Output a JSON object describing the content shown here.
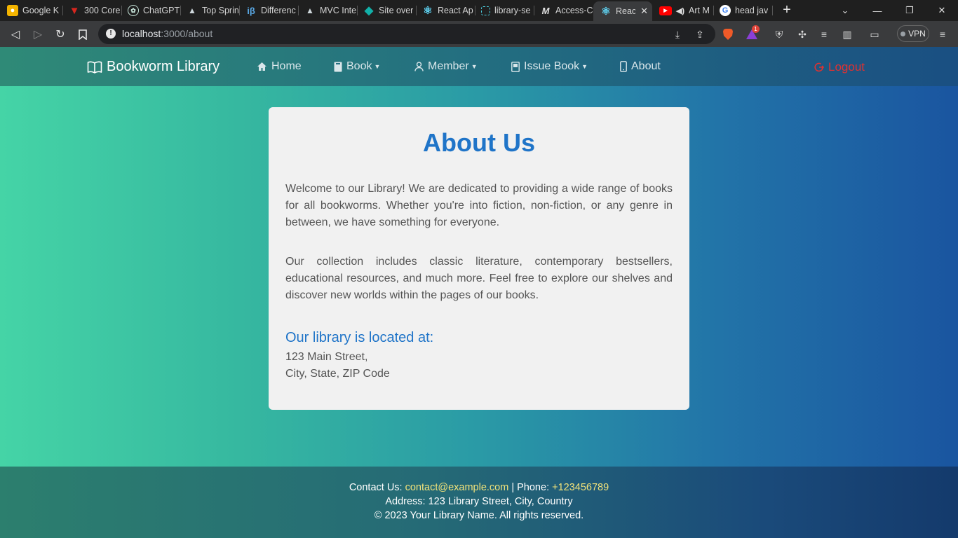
{
  "browser": {
    "tabs": [
      {
        "title": "Google K",
        "icon": "keep-icon",
        "color": "#f4b400"
      },
      {
        "title": "300 Core",
        "icon": "v-logo-icon",
        "color": "#d7261e"
      },
      {
        "title": "ChatGPT",
        "icon": "chatgpt-icon",
        "color": "#10a37f"
      },
      {
        "title": "Top Sprin",
        "icon": "mountain-icon",
        "color": "#cfd8dc"
      },
      {
        "title": "Differenc",
        "icon": "ib-icon",
        "color": "#5aa9e6"
      },
      {
        "title": "MVC Inte",
        "icon": "mountain-icon",
        "color": "#cfd8dc"
      },
      {
        "title": "Site over",
        "icon": "diamond-icon",
        "color": "#12b0a8"
      },
      {
        "title": "React Ap",
        "icon": "react-icon",
        "color": "#61dafb"
      },
      {
        "title": "library-se",
        "icon": "bracket-icon",
        "color": "#4dd0e1"
      },
      {
        "title": "Access-C",
        "icon": "m-icon",
        "color": "#e0e0e0"
      },
      {
        "title": "React",
        "icon": "react-icon",
        "color": "#61dafb"
      },
      {
        "title": "Art M",
        "icon": "youtube-icon",
        "color": "#ff0000"
      },
      {
        "title": "head jav",
        "icon": "google-icon",
        "color": "#4285f4"
      }
    ],
    "active_tab_close": "✕",
    "new_tab": "+",
    "url_host": "localhost",
    "url_path": ":3000/about",
    "vpn_label": "VPN",
    "brave_badge": "1"
  },
  "navbar": {
    "brand": "Bookworm Library",
    "items": [
      {
        "label": "Home",
        "icon": "home-icon",
        "dropdown": false
      },
      {
        "label": "Book",
        "icon": "book-icon",
        "dropdown": true
      },
      {
        "label": "Member",
        "icon": "person-icon",
        "dropdown": true
      },
      {
        "label": "Issue Book",
        "icon": "book-issue-icon",
        "dropdown": true
      },
      {
        "label": "About",
        "icon": "phone-icon",
        "dropdown": false
      }
    ],
    "logout": "Logout"
  },
  "about": {
    "title": "About Us",
    "para1": "Welcome to our Library! We are dedicated to providing a wide range of books for all bookworms. Whether you're into fiction, non-fiction, or any genre in between, we have something for everyone.",
    "para2": "Our collection includes classic literature, contemporary bestsellers, educational resources, and much more. Feel free to explore our shelves and discover new worlds within the pages of our books.",
    "location_heading": "Our library is located at:",
    "address_line1": "123 Main Street,",
    "address_line2": "City, State, ZIP Code"
  },
  "footer": {
    "contact_prefix": "Contact Us: ",
    "email": "contact@example.com",
    "phone_prefix": " | Phone: ",
    "phone": "+123456789",
    "address": "Address: 123 Library Street, City, Country",
    "copyright": "© 2023 Your Library Name. All rights reserved."
  },
  "colors": {
    "accent": "#1f74c8",
    "logout": "#e03131",
    "footer_link": "#f1e27a"
  }
}
